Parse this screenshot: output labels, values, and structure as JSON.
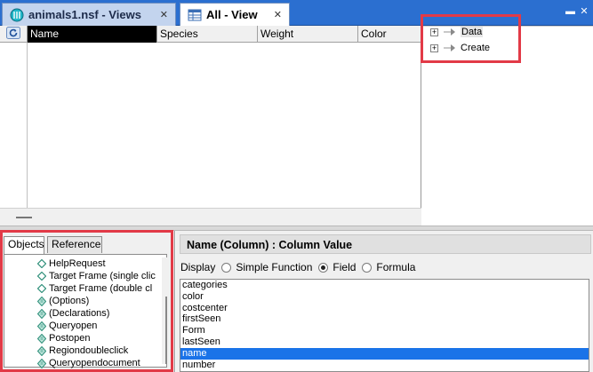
{
  "tabs": [
    {
      "label": "animals1.nsf - Views",
      "close": "✕"
    },
    {
      "label": "All - View",
      "close": "✕"
    }
  ],
  "window_buttons": {
    "minimize": "▬",
    "close": "✕"
  },
  "view": {
    "columns": [
      "Name",
      "Species",
      "Weight",
      "Color"
    ]
  },
  "right_panel": {
    "tree": [
      "Data",
      "Create"
    ]
  },
  "objects_panel": {
    "tabs": [
      "Objects",
      "Reference"
    ],
    "items": [
      "HelpRequest",
      "Target Frame (single clic",
      "Target Frame (double cl",
      "(Options)",
      "(Declarations)",
      "Queryopen",
      "Postopen",
      "Regiondoubleclick",
      "Queryopendocument"
    ]
  },
  "editor": {
    "title": "Name (Column) : Column Value",
    "display_label": "Display",
    "options": [
      "Simple Function",
      "Field",
      "Formula"
    ],
    "selected_option": "Field",
    "fields": [
      "categories",
      "color",
      "costcenter",
      "firstSeen",
      "Form",
      "lastSeen",
      "name",
      "number"
    ],
    "selected_field": "name"
  },
  "colors": {
    "tabstrip": "#2b6fd0",
    "highlight_box": "#e23a47",
    "selection": "#1a73e8"
  },
  "icons": {
    "views_tab": "globe-db-icon",
    "view_tab": "view-grid-icon",
    "refresh": "refresh-icon",
    "tree_expand": "plus-box-icon",
    "tree_node": "arrow-node-icon",
    "event": "diamond-event-icon",
    "script": "script-diamond-icon"
  }
}
